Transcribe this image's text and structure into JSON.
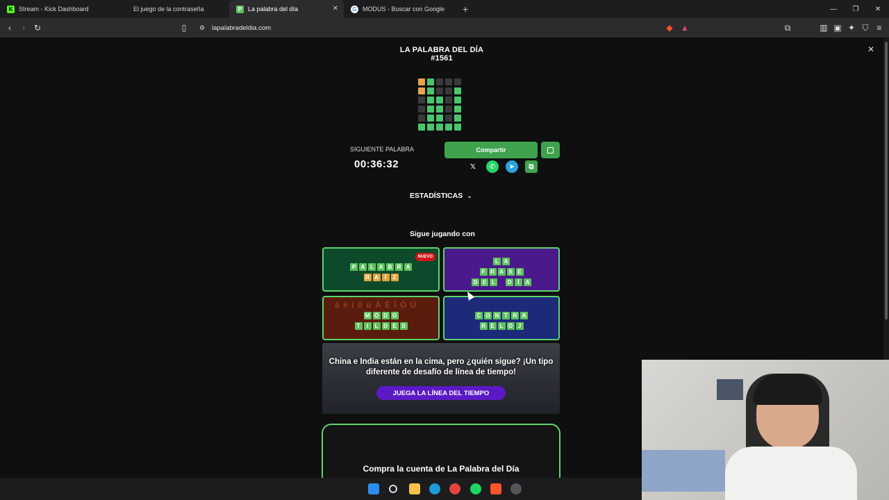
{
  "tabs": [
    {
      "label": "Stream - Kick Dashboard",
      "icon": "kick-icon",
      "color": "#53fc18"
    },
    {
      "label": "El juego de la contraseña",
      "icon": ""
    },
    {
      "label": "La palabra del día",
      "icon": "palabra-icon",
      "color": "#5ec25f",
      "active": true
    },
    {
      "label": "MODUS - Buscar con Google",
      "icon": "google-icon",
      "color": "#ffffff"
    }
  ],
  "address_bar": {
    "url": "lapalabradeldia.com"
  },
  "game": {
    "title": "LA PALABRA DEL DÍA",
    "number": "#1561",
    "grid": [
      [
        "y",
        "g",
        "d",
        "d",
        "d"
      ],
      [
        "y",
        "g",
        "d",
        "d",
        "g"
      ],
      [
        "d",
        "g",
        "g",
        "d",
        "g"
      ],
      [
        "d",
        "g",
        "g",
        "d",
        "g"
      ],
      [
        "d",
        "g",
        "g",
        "d",
        "g"
      ],
      [
        "g",
        "g",
        "g",
        "g",
        "g"
      ]
    ],
    "next_word_label": "SIGUIENTE PALABRA",
    "timer": "00:36:32",
    "share_label": "Compartir",
    "stats_label": "ESTADÍSTICAS",
    "keep_playing_label": "Sigue jugando con"
  },
  "cards": [
    {
      "rows": [
        [
          "P",
          "A",
          "L",
          "A",
          "B",
          "R",
          "A"
        ],
        [
          "R",
          "A",
          "Í",
          "Z"
        ]
      ],
      "badge": "NUEVO",
      "bg": "#0d4a2b"
    },
    {
      "rows": [
        [
          "L",
          "A"
        ],
        [
          "F",
          "R",
          "A",
          "S",
          "E"
        ],
        [
          "D",
          "E",
          "L",
          " ",
          "D",
          "Í",
          "A"
        ]
      ],
      "bg": "#4a1a8c"
    },
    {
      "rows": [
        [
          "M",
          "O",
          "D",
          "O"
        ],
        [
          "T",
          "I",
          "L",
          "D",
          "E",
          "S"
        ]
      ],
      "bg": "#5a1c0c",
      "deco": "á é í ó ú Á É Í Ó Ú"
    },
    {
      "rows": [
        [
          "C",
          "O",
          "N",
          "T",
          "R",
          "A"
        ],
        [
          "R",
          "E",
          "L",
          "O",
          "J"
        ]
      ],
      "bg": "#1d2a7a"
    }
  ],
  "timeline": {
    "text": "China e India están en la cima, pero ¿quién sigue? ¡Un tipo diferente de desafío de línea de tiempo!",
    "button": "JUEGA LA LÍNEA DEL TIEMPO"
  },
  "buy": {
    "text": "Compra la cuenta de La Palabra del Día"
  }
}
